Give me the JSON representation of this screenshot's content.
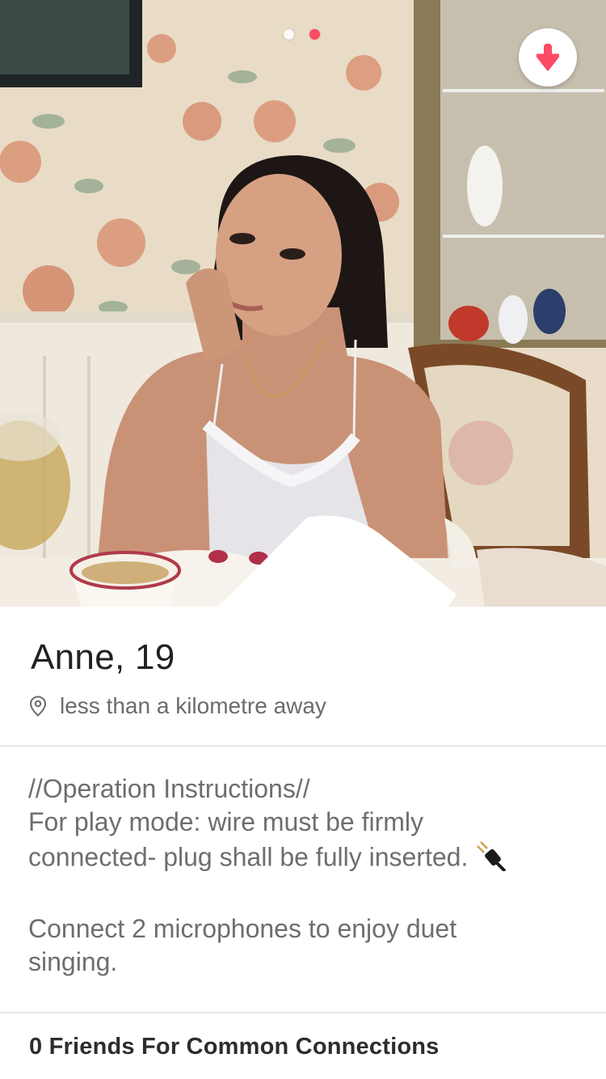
{
  "photo": {
    "dots": [
      {
        "state": "inactive"
      },
      {
        "state": "active"
      }
    ],
    "collapse_icon": "arrow-down-icon",
    "accent": "#fd4a65"
  },
  "profile": {
    "name_age": "Anne, 19",
    "distance_icon": "location-pin-icon",
    "distance": "less than a kilometre away"
  },
  "bio": {
    "lines": [
      "//Operation Instructions//",
      "For play mode: wire must be firmly",
      "connected- plug shall be fully inserted."
    ],
    "plug_icon": "electric-plug-emoji",
    "lines2": [
      "Connect 2 microphones to enjoy duet",
      "singing."
    ]
  },
  "connections": {
    "label": "0 Friends For Common Connections"
  }
}
